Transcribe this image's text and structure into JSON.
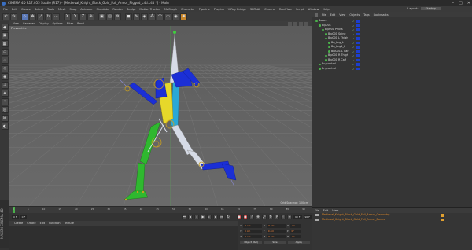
{
  "window": {
    "title": "CINEMA 4D R17.055 Studio (R17) - [Medieval_Knight_Black_Gold_Full_Armor_Rigged_c4d.c4d *] - Main",
    "controls": [
      "–",
      "□",
      "✕"
    ]
  },
  "menubar": {
    "items": [
      "File",
      "Edit",
      "Create",
      "Select",
      "Tools",
      "Mesh",
      "Snap",
      "Animate",
      "Simulate",
      "Render",
      "Sculpt",
      "Motion Tracker",
      "MoGraph",
      "Character",
      "Pipeline",
      "Plugins",
      "V-Ray Bridge",
      "3DToAll",
      "Cinema",
      "RealFlow",
      "Script",
      "Window",
      "Help"
    ],
    "layout_label": "Layout:",
    "layout_value": "Startup"
  },
  "viewport": {
    "menu": [
      "View",
      "Cameras",
      "Display",
      "Options",
      "Filter",
      "Panel"
    ],
    "label": "Perspective",
    "grid_spacing": "Grid Spacing : 100 cm"
  },
  "object_manager": {
    "menu": [
      "File",
      "Edit",
      "View",
      "Objects",
      "Tags",
      "Bookmarks"
    ],
    "objects": [
      {
        "name": "Bones",
        "indent": 0
      },
      {
        "name": "Bip001",
        "indent": 1
      },
      {
        "name": "Bip001 Pelvis",
        "indent": 2
      },
      {
        "name": "Bip001 Spine",
        "indent": 3
      },
      {
        "name": "Bip001 L Thigh",
        "indent": 3
      },
      {
        "name": "Bn_Leg_L",
        "indent": 4
      },
      {
        "name": "Bn_Leg1_L",
        "indent": 4
      },
      {
        "name": "Bip001 L Calf",
        "indent": 4
      },
      {
        "name": "Bip001 R Thigh",
        "indent": 3
      },
      {
        "name": "Bip001 R Calf",
        "indent": 3
      },
      {
        "name": "Bn_control",
        "indent": 1
      },
      {
        "name": "Bn_control",
        "indent": 1
      }
    ]
  },
  "timeline": {
    "ticks": [
      "0",
      "5",
      "10",
      "15",
      "20",
      "25",
      "30",
      "35",
      "40",
      "45",
      "50",
      "55",
      "60",
      "65",
      "70",
      "75",
      "80",
      "85",
      "90"
    ],
    "current_frame": "0 F",
    "start_frame": "0 F",
    "end_frame": "90 F",
    "end_frame2": "90 F"
  },
  "material_manager": {
    "menu": [
      "Create",
      "Create",
      "Edit",
      "Function",
      "Texture"
    ]
  },
  "coordinates": {
    "rows": [
      {
        "axis": "X",
        "pos": "0 cm",
        "axis2": "X",
        "size": "0 cm",
        "axis3": "H",
        "rot": "0°"
      },
      {
        "axis": "Y",
        "pos": "0 cm",
        "axis2": "Y",
        "size": "0 cm",
        "axis3": "P",
        "rot": "0°"
      },
      {
        "axis": "Z",
        "pos": "0 cm",
        "axis2": "Z",
        "size": "0 cm",
        "axis3": "B",
        "rot": "0°"
      }
    ],
    "mode1": "Object (Rel)",
    "mode2": "Size",
    "apply": "Apply"
  },
  "layers_panel": {
    "menu": [
      "File",
      "Edit",
      "View"
    ],
    "items": [
      "Medieval_Knight_Black_Gold_Full_Armor_Geometry",
      "Medieval_Knight_Black_Gold_Full_Armor_Bones"
    ]
  },
  "brand": "MAXON CINEMA 4D",
  "colors": {
    "bone_green": "#2fb82f",
    "bone_blue": "#1b2fd6",
    "bone_yellow": "#e6d82a",
    "bone_cyan": "#29a8d6",
    "bone_white": "#d6dbe6",
    "axis_green": "#3fcf3f",
    "tag_blue": "#1c3ecf",
    "material_orange": "#e08a2b"
  }
}
